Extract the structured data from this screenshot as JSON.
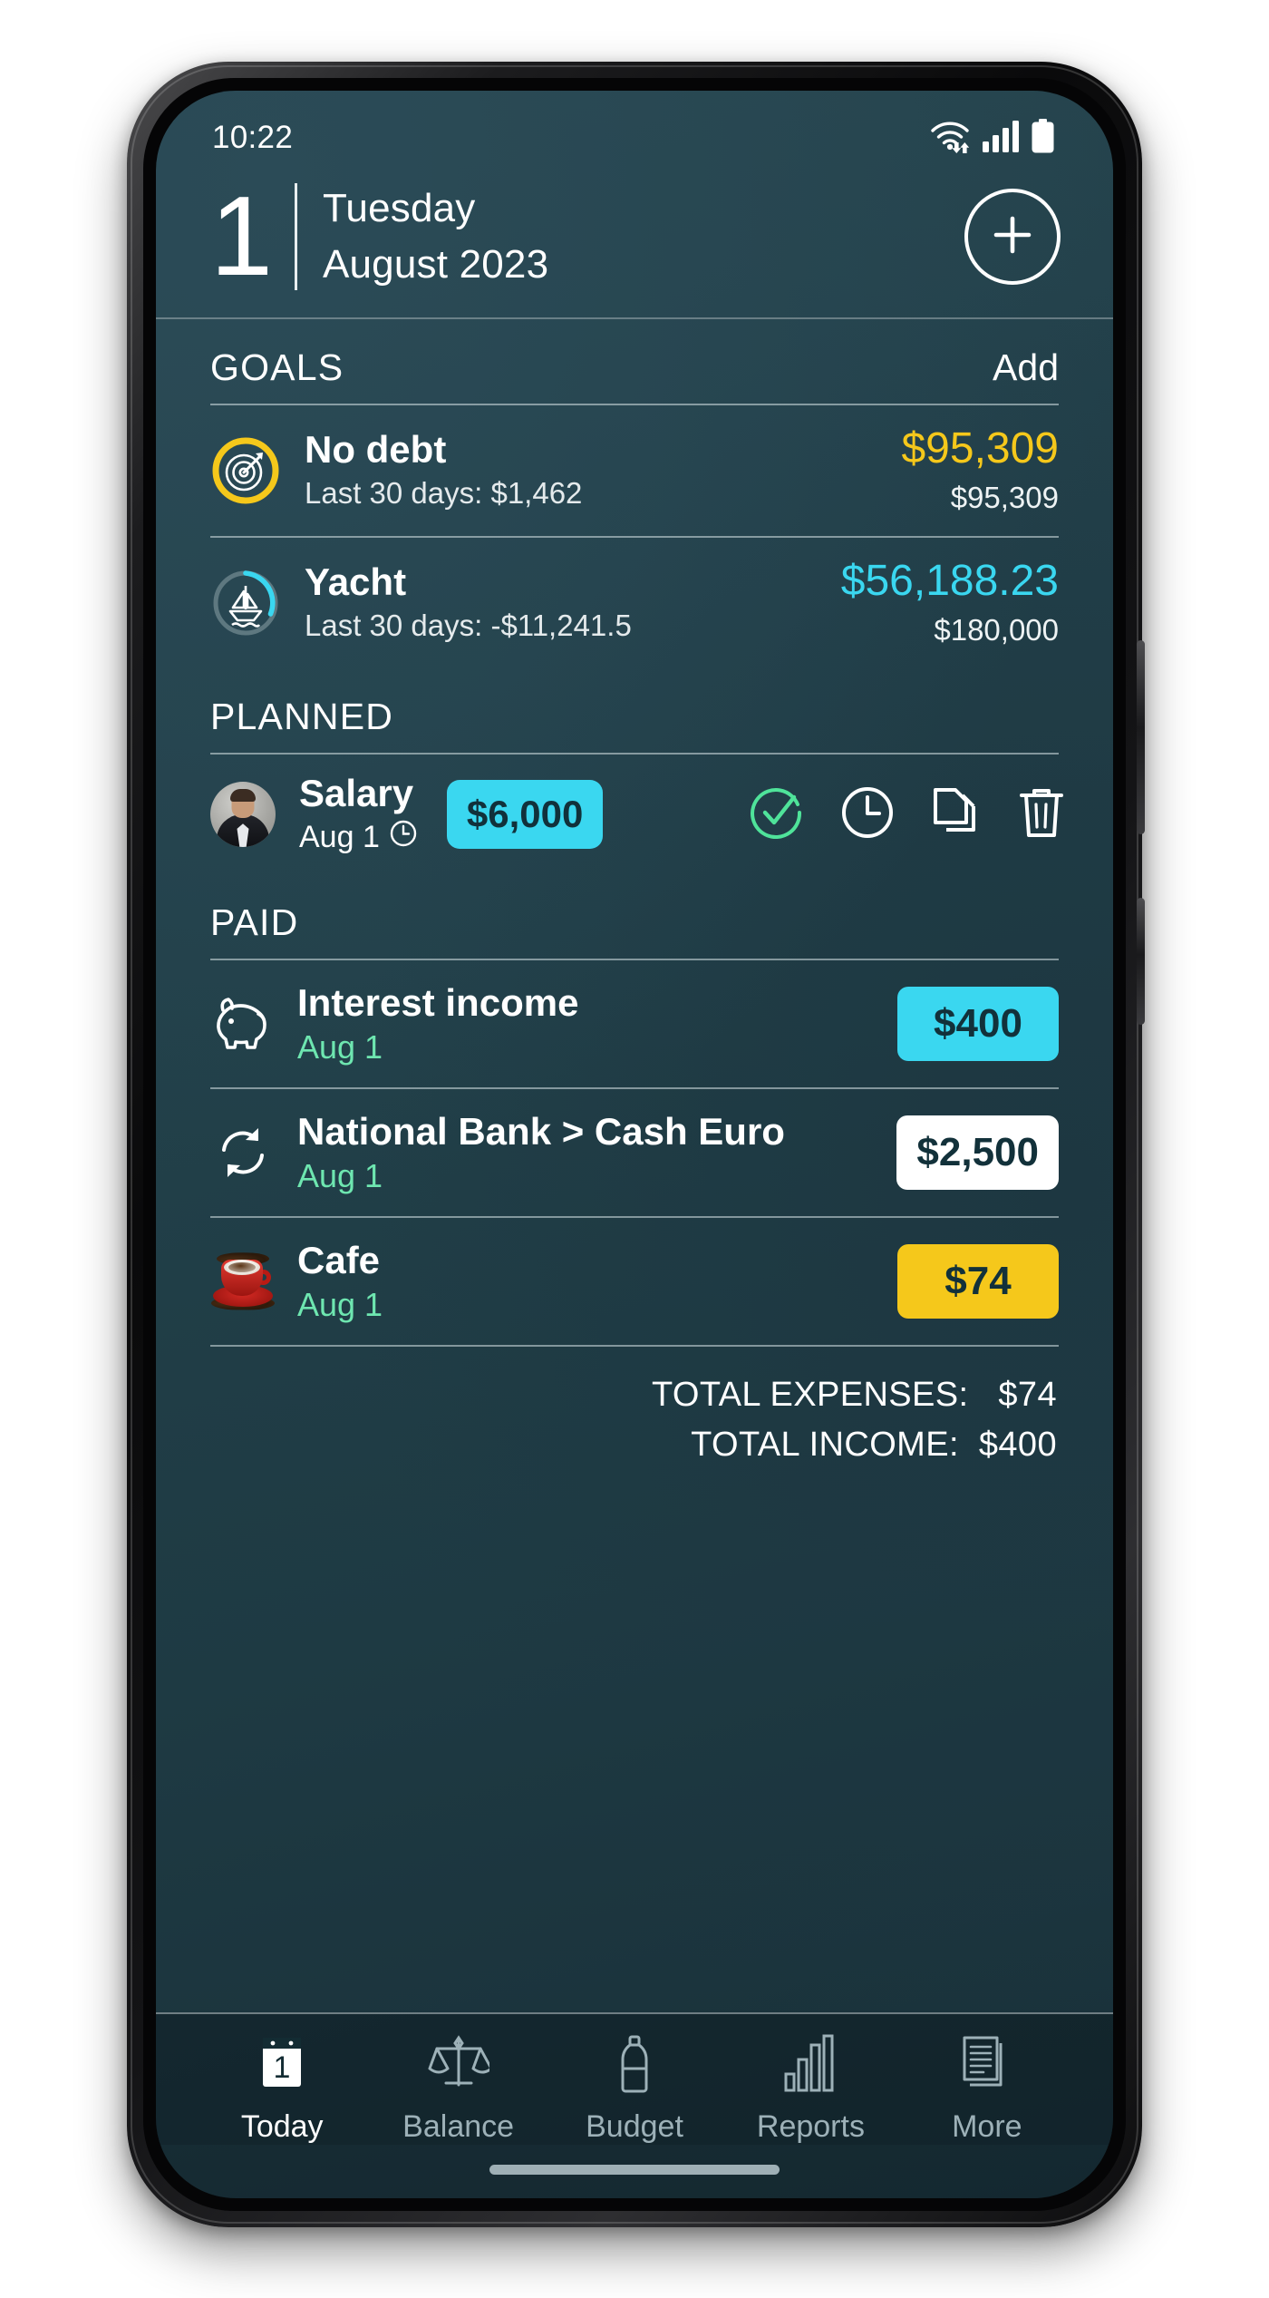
{
  "status_bar": {
    "time": "10:22",
    "icons": [
      "wifi-icon",
      "cellular-signal-icon",
      "battery-icon"
    ]
  },
  "header": {
    "day": "1",
    "weekday": "Tuesday",
    "month_year": "August 2023",
    "add_button": "add-circle-icon"
  },
  "goals_section": {
    "title": "GOALS",
    "action": "Add",
    "items": [
      {
        "icon": "target-icon",
        "name": "No debt",
        "subtitle": "Last 30 days: $1,462",
        "current": "$95,309",
        "total": "$95,309",
        "accent": "#f5c81b",
        "progress": 100
      },
      {
        "icon": "sailboat-icon",
        "name": "Yacht",
        "subtitle": "Last 30 days: -$11,241.5",
        "current": "$56,188.23",
        "total": "$180,000",
        "accent": "#3ad7f0",
        "progress": 31
      }
    ]
  },
  "planned_section": {
    "title": "PLANNED",
    "items": [
      {
        "icon": "avatar",
        "name": "Salary",
        "date": "Aug 1",
        "date_icon": "clock-icon",
        "amount": "$6,000",
        "amount_color": "#3ad7f0",
        "actions": [
          "check-circle-icon",
          "clock-circle-icon",
          "copy-icon",
          "trash-icon"
        ]
      }
    ]
  },
  "paid_section": {
    "title": "PAID",
    "items": [
      {
        "icon": "piggy-bank-icon",
        "name": "Interest income",
        "date": "Aug 1",
        "amount": "$400",
        "amount_style": "amt-cyan"
      },
      {
        "icon": "transfer-icon",
        "name": "National Bank > Cash Euro",
        "date": "Aug 1",
        "amount": "$2,500",
        "amount_style": "amt-white"
      },
      {
        "icon": "coffee-cup-icon",
        "name": "Cafe",
        "date": "Aug 1",
        "amount": "$74",
        "amount_style": "amt-gold"
      }
    ]
  },
  "totals": {
    "expenses_label": "TOTAL EXPENSES:",
    "expenses_value": "$74",
    "income_label": "TOTAL INCOME:",
    "income_value": "$400"
  },
  "tabbar": {
    "items": [
      {
        "label": "Today",
        "icon": "calendar-icon",
        "active": true,
        "badge": "1"
      },
      {
        "label": "Balance",
        "icon": "scales-icon",
        "active": false
      },
      {
        "label": "Budget",
        "icon": "bottle-icon",
        "active": false
      },
      {
        "label": "Reports",
        "icon": "bar-chart-icon",
        "active": false
      },
      {
        "label": "More",
        "icon": "documents-icon",
        "active": false
      }
    ]
  },
  "colors": {
    "background_top": "#27464f",
    "background_bottom": "#182f37",
    "accent_cyan": "#3ad7f0",
    "accent_gold": "#f5c81b",
    "accent_green": "#6ee6b0"
  }
}
